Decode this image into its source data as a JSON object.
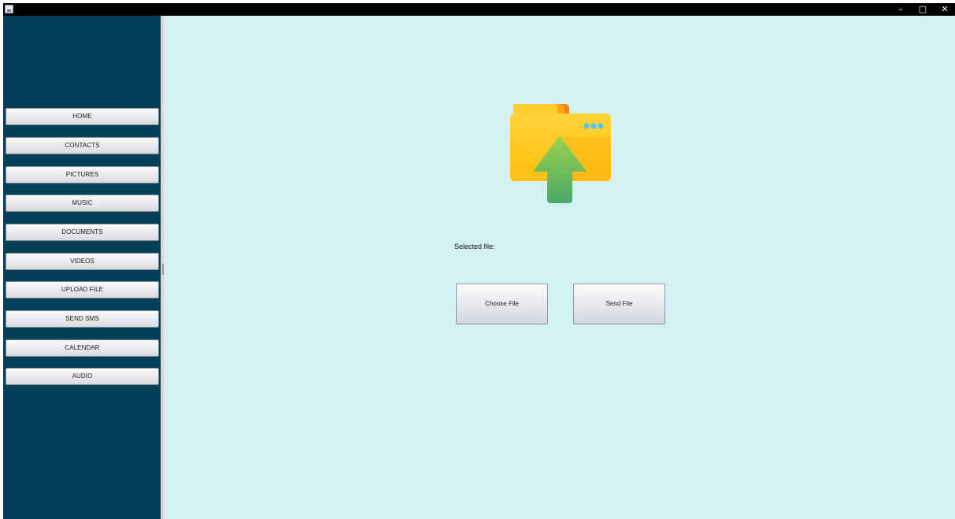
{
  "window": {
    "controls": {
      "minimize": "–",
      "maximize": "□",
      "close": "✕"
    }
  },
  "sidebar": {
    "items": [
      {
        "label": "HOME"
      },
      {
        "label": "CONTACTS"
      },
      {
        "label": "PICTURES"
      },
      {
        "label": "MUSIC"
      },
      {
        "label": "DOCUMENTS"
      },
      {
        "label": "VIDEOS"
      },
      {
        "label": "UPLOAD FILE"
      },
      {
        "label": "SEND SMS"
      },
      {
        "label": "CALENDAR"
      },
      {
        "label": "AUDIO"
      }
    ]
  },
  "main": {
    "illustration_icon": "folder-upload-icon",
    "selected_file_label": "Selected file:",
    "choose_button": "Choose File",
    "send_button": "Send File"
  },
  "colors": {
    "sidebar_bg": "#043f5a",
    "main_bg": "#d3f0f2",
    "titlebar_bg": "#000000"
  }
}
